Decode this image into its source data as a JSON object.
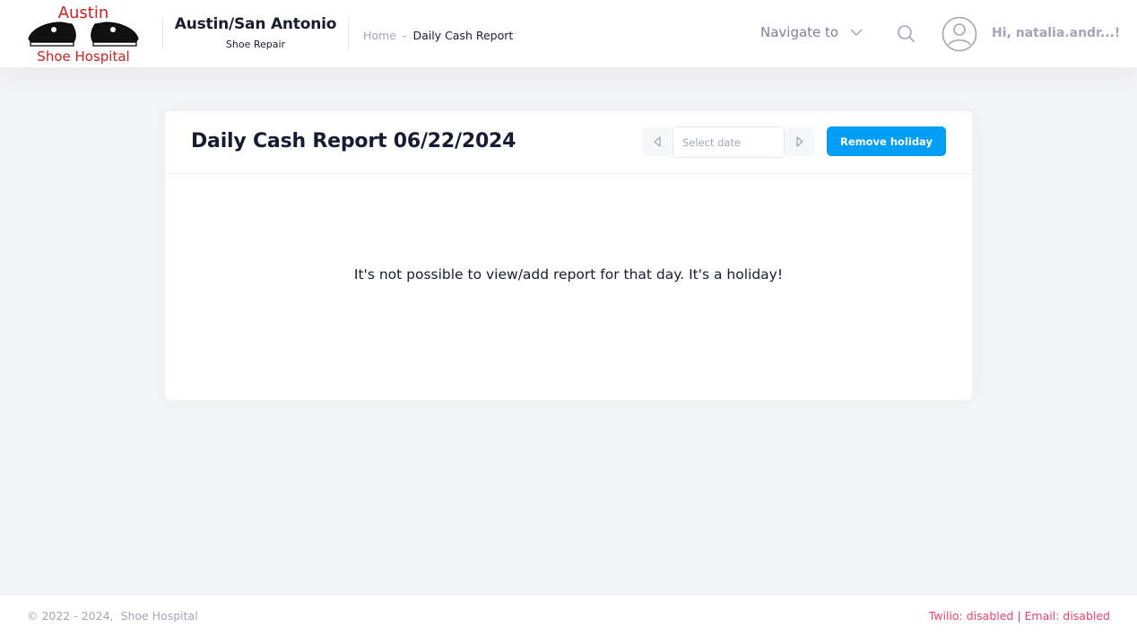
{
  "header": {
    "logo": {
      "line1": "Austin",
      "line2": "Shoe Hospital"
    },
    "brand_title": "Austin/San Antonio",
    "brand_subtitle": "Shoe Repair",
    "breadcrumb": {
      "home": "Home",
      "separator": "-",
      "current": "Daily Cash Report"
    },
    "navigate_label": "Navigate to",
    "greeting": "Hi, natalia.andr...!"
  },
  "card": {
    "title": "Daily Cash Report 06/22/2024",
    "date_placeholder": "Select date",
    "remove_button": "Remove holiday",
    "message": "It's not possible to view/add report for that day. It's a holiday!"
  },
  "footer": {
    "copyright": "© 2022 - 2024,",
    "company": "Shoe Hospital",
    "status": "Twilio: disabled | Email: disabled"
  },
  "colors": {
    "primary": "#009ef7",
    "danger": "#f1416c",
    "logo_red": "#cc1f1f",
    "muted": "#a1a5b7"
  },
  "icons": [
    "logo-icon",
    "chevron-down-icon",
    "search-icon",
    "user-avatar-icon",
    "caret-left-icon",
    "caret-right-icon"
  ]
}
